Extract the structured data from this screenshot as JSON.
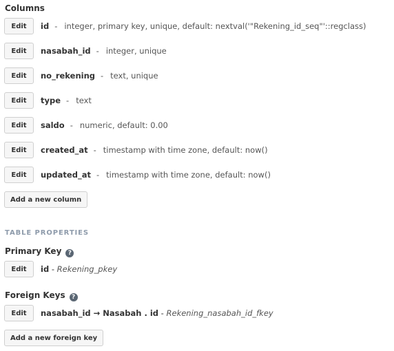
{
  "columns_heading": "Columns",
  "edit_label": "Edit",
  "separator": "-",
  "columns": [
    {
      "name": "id",
      "desc": "integer, primary key, unique, default: nextval('\"Rekening_id_seq\"'::regclass)"
    },
    {
      "name": "nasabah_id",
      "desc": "integer, unique"
    },
    {
      "name": "no_rekening",
      "desc": "text, unique"
    },
    {
      "name": "type",
      "desc": "text"
    },
    {
      "name": "saldo",
      "desc": "numeric, default: 0.00"
    },
    {
      "name": "created_at",
      "desc": "timestamp with time zone, default: now()"
    },
    {
      "name": "updated_at",
      "desc": "timestamp with time zone, default: now()"
    }
  ],
  "add_column_label": "Add a new column",
  "table_properties_heading": "TABLE PROPERTIES",
  "primary_key": {
    "heading": "Primary Key",
    "help_glyph": "?",
    "column": "id",
    "dash": " - ",
    "constraint": "Rekening_pkey"
  },
  "foreign_keys": {
    "heading": "Foreign Keys",
    "help_glyph": "?",
    "items": [
      {
        "reference": "nasabah_id → Nasabah . id",
        "dash": " - ",
        "constraint": "Rekening_nasabah_id_fkey"
      }
    ],
    "add_label": "Add a new foreign key"
  }
}
